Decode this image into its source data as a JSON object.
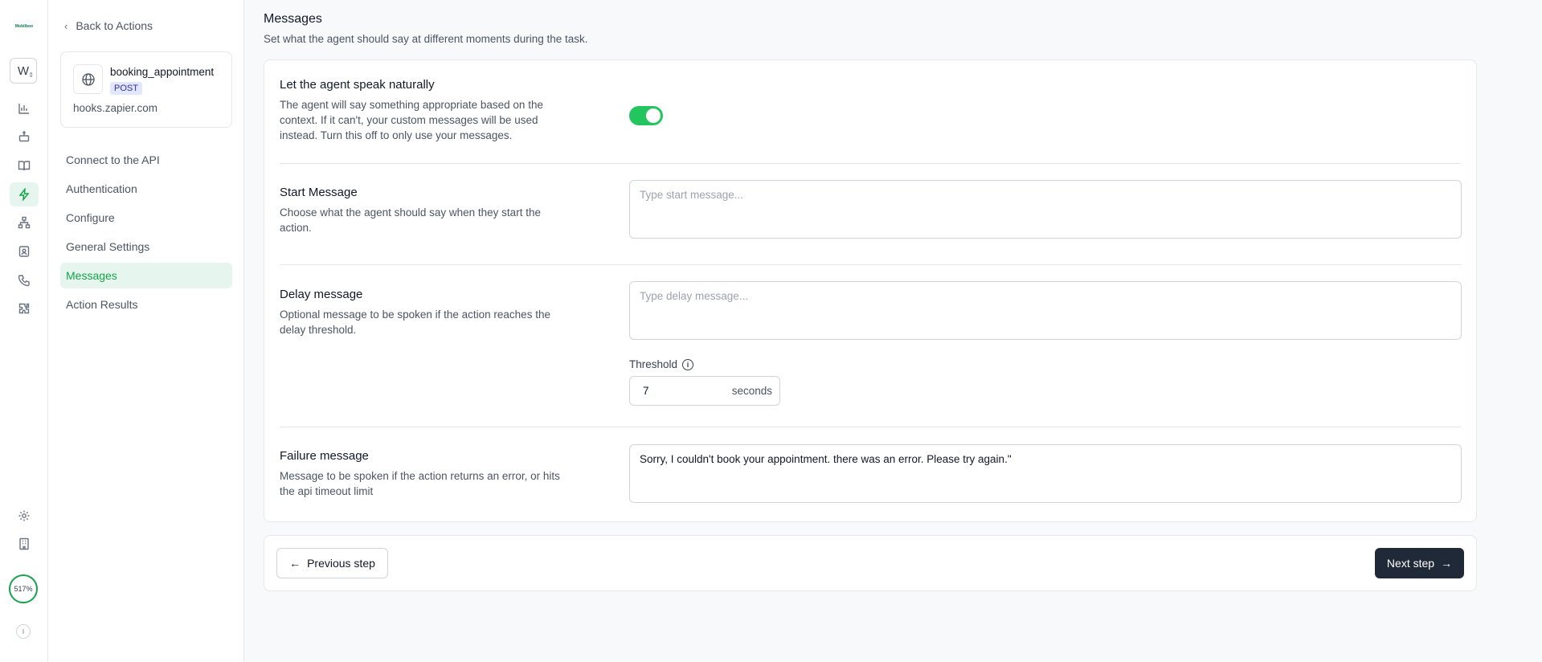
{
  "rail": {
    "logo": "Mobilboo",
    "workspace_initial": "W",
    "credits": "517%",
    "user_initial": "I",
    "icons": [
      "bar-chart-icon",
      "robot-icon",
      "book-icon",
      "lightning-icon",
      "workflow-icon",
      "contact-card-icon",
      "phone-icon",
      "puzzle-icon",
      "gear-icon",
      "building-icon"
    ],
    "accent": "#16a34a"
  },
  "sidebar": {
    "back_label": "Back to Actions",
    "action": {
      "name": "booking_appointment",
      "method": "POST",
      "host": "hooks.zapier.com"
    },
    "nav": [
      {
        "label": "Connect to the API"
      },
      {
        "label": "Authentication"
      },
      {
        "label": "Configure"
      },
      {
        "label": "General Settings"
      },
      {
        "label": "Messages"
      },
      {
        "label": "Action Results"
      }
    ]
  },
  "main": {
    "title": "Messages",
    "subtitle": "Set what the agent should say at different moments during the task.",
    "speak_naturally": {
      "title": "Let the agent speak naturally",
      "description": "The agent will say something appropriate based on the context. If it can't, your custom messages will be used instead. Turn this off to only use your messages.",
      "enabled": true
    },
    "start_message": {
      "title": "Start Message",
      "description": "Choose what the agent should say when they start the action.",
      "placeholder": "Type start message...",
      "value": ""
    },
    "delay_message": {
      "title": "Delay message",
      "description": "Optional message to be spoken if the action reaches the delay threshold.",
      "placeholder": "Type delay message...",
      "value": "",
      "threshold_label": "Threshold",
      "threshold_value": "7",
      "threshold_unit": "seconds"
    },
    "failure_message": {
      "title": "Failure message",
      "description": "Message to be spoken if the action returns an error, or hits the api timeout limit",
      "value": "Sorry, I couldn't book your appointment. there was an error. Please try again.\""
    },
    "footer": {
      "prev_label": "Previous step",
      "next_label": "Next step"
    }
  }
}
